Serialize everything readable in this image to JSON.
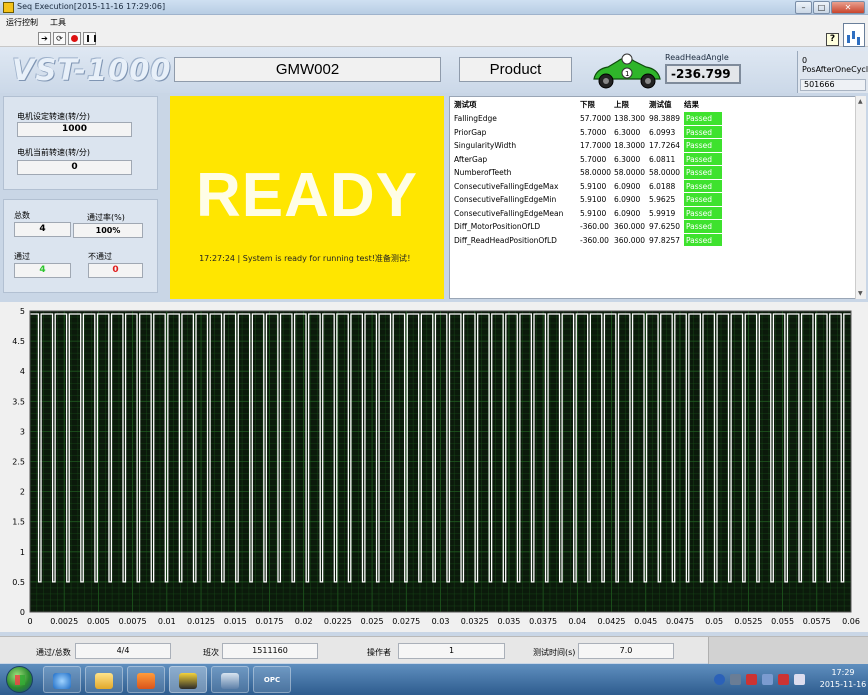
{
  "window": {
    "title": "Seq Execution[2015-11-16 17:29:06]",
    "min_label": "–",
    "max_label": "□",
    "close_label": "✕"
  },
  "menu": [
    "运行控制",
    "工具"
  ],
  "toolbar": {
    "help_label": "?"
  },
  "header": {
    "logo": "VST-1000",
    "model": "GMW002",
    "product": "Product",
    "read_head_label": "ReadHeadAngle",
    "read_head_value": "-236.799",
    "pos_index": "0",
    "pos_label": "PosAfterOneCycl",
    "pos_value": "501666"
  },
  "left": {
    "motor_set_label": "电机设定转速(转/分)",
    "motor_set_value": "1000",
    "motor_cur_label": "电机当前转速(转/分)",
    "motor_cur_value": "0",
    "total_label": "总数",
    "total_value": "4",
    "pass_rate_label": "通过率(%)",
    "pass_rate_value": "100%",
    "pass_label": "通过",
    "pass_value": "4",
    "fail_label": "不通过",
    "fail_value": "0"
  },
  "status": {
    "big": "READY",
    "message": "17:27:24 | System is ready for running test!准备测试！"
  },
  "results": {
    "headers": [
      "测试项",
      "下限",
      "上限",
      "测试值",
      "结果"
    ],
    "rows": [
      [
        "FallingEdge",
        "57.7000",
        "138.300",
        "98.3889",
        "Passed"
      ],
      [
        "PriorGap",
        "5.7000",
        "6.3000",
        "6.0993",
        "Passed"
      ],
      [
        "SingularityWidth",
        "17.7000",
        "18.3000",
        "17.7264",
        "Passed"
      ],
      [
        "AfterGap",
        "5.7000",
        "6.3000",
        "6.0811",
        "Passed"
      ],
      [
        "NumberofTeeth",
        "58.0000",
        "58.0000",
        "58.0000",
        "Passed"
      ],
      [
        "ConsecutiveFallingEdgeMax",
        "5.9100",
        "6.0900",
        "6.0188",
        "Passed"
      ],
      [
        "ConsecutiveFallingEdgeMin",
        "5.9100",
        "6.0900",
        "5.9625",
        "Passed"
      ],
      [
        "ConsecutiveFallingEdgeMean",
        "5.9100",
        "6.0900",
        "5.9919",
        "Passed"
      ],
      [
        "Diff_MotorPositionOfLD",
        "-360.00",
        "360.000",
        "97.6250",
        "Passed"
      ],
      [
        "Diff_ReadHeadPositionOfLD",
        "-360.00",
        "360.000",
        "97.8257",
        "Passed"
      ]
    ],
    "passed_color": "#3ee22e"
  },
  "chart_data": {
    "type": "line",
    "title": "",
    "xlabel": "",
    "ylabel": "",
    "xlim": [
      0,
      0.06
    ],
    "ylim": [
      0,
      5
    ],
    "x_ticks": [
      "0",
      "0.0025",
      "0.005",
      "0.0075",
      "0.01",
      "0.0125",
      "0.015",
      "0.0175",
      "0.02",
      "0.0225",
      "0.025",
      "0.0275",
      "0.03",
      "0.0325",
      "0.035",
      "0.0375",
      "0.04",
      "0.0425",
      "0.045",
      "0.0475",
      "0.05",
      "0.0525",
      "0.055",
      "0.0575",
      "0.06"
    ],
    "y_ticks": [
      "0",
      "0.5",
      "1",
      "1.5",
      "2",
      "2.5",
      "3",
      "3.5",
      "4",
      "4.5",
      "5"
    ],
    "high_level": 4.95,
    "low_level": 0.5,
    "pulse_count": 58,
    "background": "#0b1a0b",
    "grid_color": "#1f5a1f",
    "trace_color": "#ffffff"
  },
  "bottom": {
    "pass_total_label": "通过/总数",
    "pass_total_value": "4/4",
    "shift_label": "班次",
    "shift_value": "1511160",
    "operator_label": "操作者",
    "operator_value": "1",
    "time_label": "测试时间(s)",
    "time_value": "7.0"
  },
  "taskbar": {
    "opc_label": "OPC",
    "time": "17:29",
    "date": "2015-11-16"
  }
}
